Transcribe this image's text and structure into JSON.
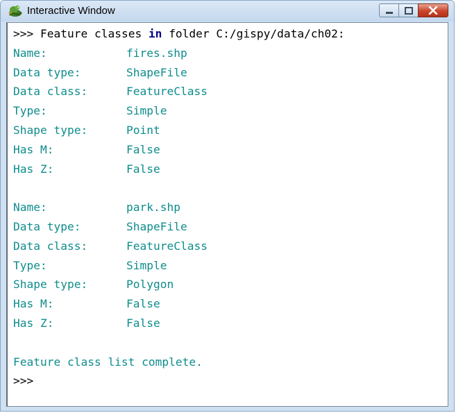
{
  "window": {
    "title": "Interactive Window",
    "icon": "python-snake-icon"
  },
  "console": {
    "prompt": ">>>",
    "header": {
      "prefix": "Feature classes",
      "keyword": "in",
      "suffix": "folder C:/gispy/data/ch02:"
    },
    "records": [
      {
        "fields": [
          {
            "label": "Name:",
            "value": "fires.shp"
          },
          {
            "label": "Data type:",
            "value": "ShapeFile"
          },
          {
            "label": "Data class:",
            "value": "FeatureClass"
          },
          {
            "label": "Type:",
            "value": "Simple"
          },
          {
            "label": "Shape type:",
            "value": "Point"
          },
          {
            "label": "Has M:",
            "value": "False"
          },
          {
            "label": "Has Z:",
            "value": "False"
          }
        ]
      },
      {
        "fields": [
          {
            "label": "Name:",
            "value": "park.shp"
          },
          {
            "label": "Data type:",
            "value": "ShapeFile"
          },
          {
            "label": "Data class:",
            "value": "FeatureClass"
          },
          {
            "label": "Type:",
            "value": "Simple"
          },
          {
            "label": "Shape type:",
            "value": "Polygon"
          },
          {
            "label": "Has M:",
            "value": "False"
          },
          {
            "label": "Has Z:",
            "value": "False"
          }
        ]
      }
    ],
    "footer": "Feature class list complete.",
    "final_prompt": ">>>"
  },
  "colors": {
    "output_text": "#0f8c8c",
    "keyword": "#00008b",
    "close_button": "#c9452b"
  }
}
